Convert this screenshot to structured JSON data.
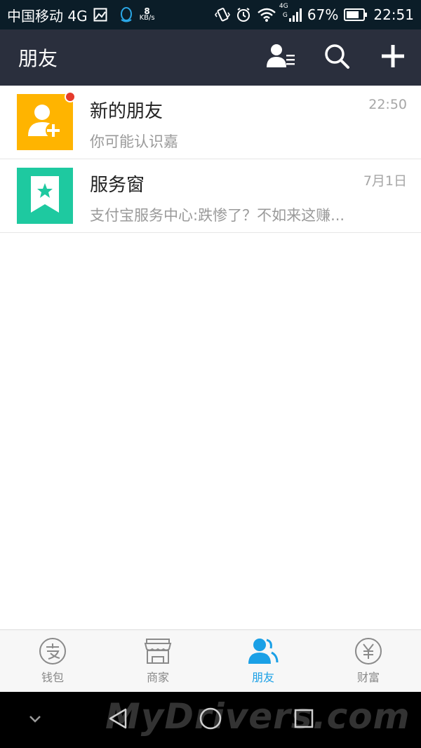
{
  "status_bar": {
    "carrier": "中国移动 4G",
    "net_speed_value": "8",
    "net_speed_unit": "KB/s",
    "signal_label_top": "4G",
    "signal_label_bottom": "G",
    "battery": "67%",
    "time": "22:51",
    "icons": [
      "image-icon",
      "qq-icon",
      "vibrate-icon",
      "alarm-icon",
      "wifi-icon",
      "signal-icon",
      "battery-icon"
    ]
  },
  "header": {
    "title": "朋友",
    "actions": [
      "contacts-icon",
      "search-icon",
      "plus-icon"
    ]
  },
  "conversations": [
    {
      "name": "新的朋友",
      "preview": "你可能认识嘉",
      "time": "22:50",
      "icon": "add-friend-icon",
      "color": "#ffb400",
      "has_badge": true
    },
    {
      "name": "服务窗",
      "preview": "支付宝服务中心:跌惨了？不如来这赚...",
      "time": "7月1日",
      "icon": "star-bookmark-icon",
      "color": "#1ec9a0",
      "has_badge": false
    }
  ],
  "tabs": [
    {
      "label": "钱包",
      "icon": "alipay-icon",
      "active": false
    },
    {
      "label": "商家",
      "icon": "store-icon",
      "active": false
    },
    {
      "label": "朋友",
      "icon": "friends-icon",
      "active": true
    },
    {
      "label": "财富",
      "icon": "yen-icon",
      "active": false
    }
  ],
  "nav": {
    "watermark": "MyDrivers.com"
  },
  "colors": {
    "status_bar": "#0b1d28",
    "header": "#2a2f3d",
    "accent": "#1aa0e6",
    "badge": "#e53b2c"
  }
}
